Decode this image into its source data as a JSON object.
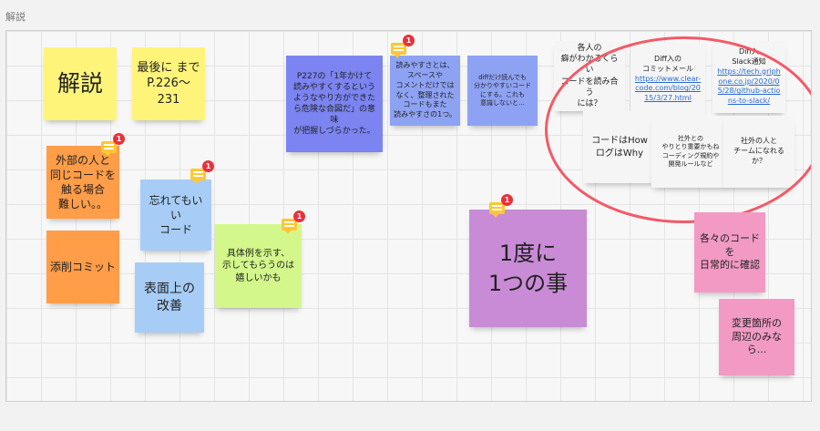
{
  "frame": {
    "title": "解説"
  },
  "stickies": {
    "s1": "解説",
    "s2": "最後に まで\nP.226〜231",
    "s3": "外部の人と\n同じコードを\n触る場合\n難しい。。",
    "s4": "添削コミット",
    "s5": "忘れてもいい\nコード",
    "s6": "表面上の\n改善",
    "s7": "具体例を示す、\n示してもらうのは\n嬉しいかも",
    "s8": "P227の「1年かけて\n読みやすくするという\nようなやり方ができたら危険な合図だ」の意味\nが把握しづらかった。",
    "s9": "読みやすさとは、\nスペースや\nコメントだけでは\nなく、整理された\nコードもまた\n読みやすさの1つ。",
    "s10": "diffだけ読んでも\n分かりやすいコード\nにする。これも\n意識しないと…",
    "s11": "各人の\n癖がわかるくらい\nコードを読み合う\nには？",
    "s12": {
      "title": "Diff入の\nコミットメール",
      "link": "https://www.clear-code.com/blog/2015/3/27.html"
    },
    "s13": {
      "title": "Diff入\nSlack通知",
      "link": "https://tech.griphone.co.jp/2020/05/28/github-actions-to-slack/"
    },
    "s14": "コードはHow\nログはWhy",
    "s15": "社外との\nやりとり重要かもね\nコーディング規約や\n開発ルールなど",
    "s16": "社外の人と\nチームになれるか？",
    "s17": "1度に\n1つの事",
    "s18": "各々のコードを\n日常的に確認",
    "s19": "変更箇所の\n周辺のみなら..."
  },
  "comments": {
    "count": "1"
  },
  "colors": {
    "yellow": "#fff47a",
    "orange": "#ff9d48",
    "blue": "#a7cdf7",
    "green": "#d3f78a",
    "indigo": "#7b84f0",
    "purple": "#c98ad6",
    "pink": "#f29ac4",
    "highlight": "#f25a66"
  }
}
